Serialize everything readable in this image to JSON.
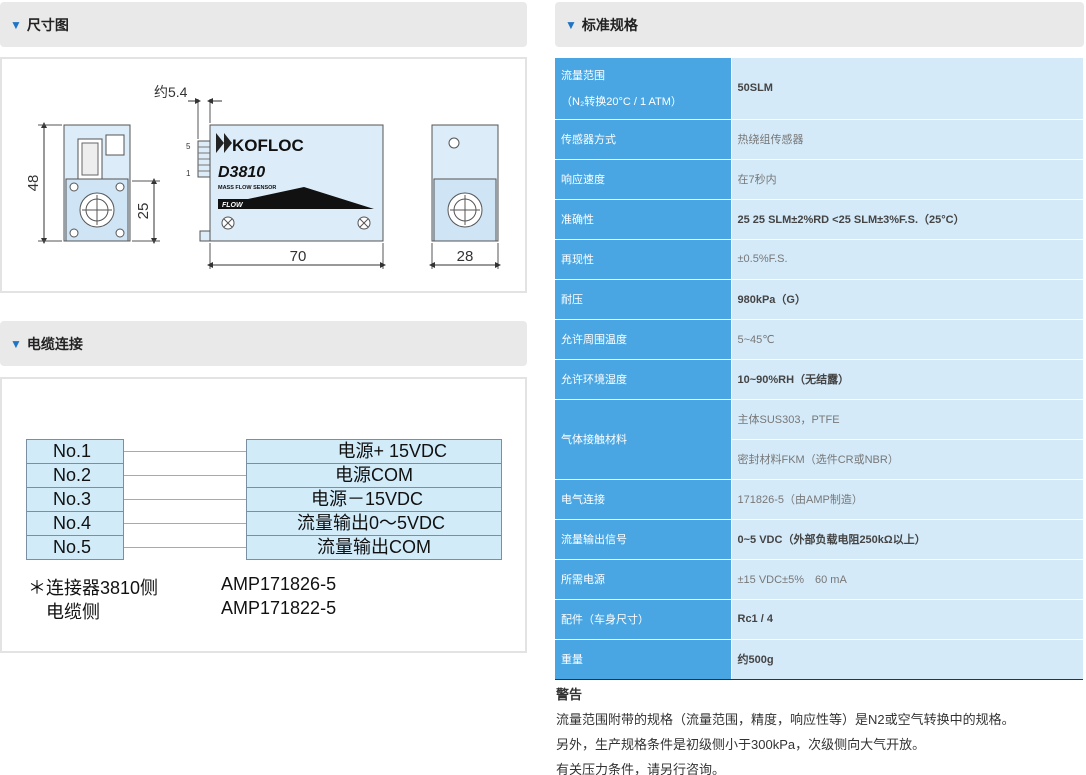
{
  "sections": {
    "dimensions_title": "尺寸图",
    "cable_title": "电缆连接",
    "specs_title": "标准规格"
  },
  "drawing": {
    "brand": "KOFLOC",
    "model": "D3810",
    "subtitle": "MASS FLOW SENSOR",
    "flow": "FLOW",
    "dim_48": "48",
    "dim_25": "25",
    "dim_54": "约5.4",
    "dim_70": "70",
    "dim_28": "28",
    "pin_5": "5",
    "pin_1": "1"
  },
  "cable": {
    "pins": [
      "No.1",
      "No.2",
      "No.3",
      "No.4",
      "No.5"
    ],
    "signals": [
      "电源+ 15VDC",
      "电源COM",
      "电源－15VDC",
      "流量输出0～5VDC",
      "流量输出COM"
    ],
    "note_label_1": "＊连接器3810侧",
    "note_label_2": "电缆侧",
    "note_value_1": "AMP171826-5",
    "note_value_2": "AMP171822-5"
  },
  "specs": [
    {
      "label": "流量范围",
      "label2": "（N₂转换20°C / 1 ATM）",
      "value": "50SLM"
    },
    {
      "label": "传感器方式",
      "value": "热绕组传感器"
    },
    {
      "label": "响应速度",
      "value": "在7秒内"
    },
    {
      "label": "准确性",
      "value": "25 25 SLM±2%RD <25 SLM±3%F.S.（25°C）"
    },
    {
      "label": "再现性",
      "value": "±0.5%F.S."
    },
    {
      "label": "耐压",
      "value": "980kPa（G）"
    },
    {
      "label": "允许周围温度",
      "value": "5~45℃"
    },
    {
      "label": "允许环境湿度",
      "value": "10~90%RH（无结露）"
    },
    {
      "label": "气体接触材料",
      "value": "主体SUS303，PTFE",
      "value2": "密封材料FKM（选件CR或NBR）"
    },
    {
      "label": "电气连接",
      "value": "171826-5（由AMP制造）"
    },
    {
      "label": "流量输出信号",
      "value": "0~5 VDC（外部负载电阻250kΩ以上）"
    },
    {
      "label": "所需电源",
      "value": "±15 VDC±5%　60 mA"
    },
    {
      "label": "配件（车身尺寸）",
      "value": "Rc1 / 4"
    },
    {
      "label": "重量",
      "value": "约500g"
    }
  ],
  "warning": {
    "title": "警告",
    "lines": [
      "流量范围附带的规格（流量范围，精度，响应性等）是N2或空气转换中的规格。",
      "另外，生产规格条件是初级侧小于300kPa，次级侧向大气开放。",
      "有关压力条件，请另行咨询。"
    ]
  }
}
